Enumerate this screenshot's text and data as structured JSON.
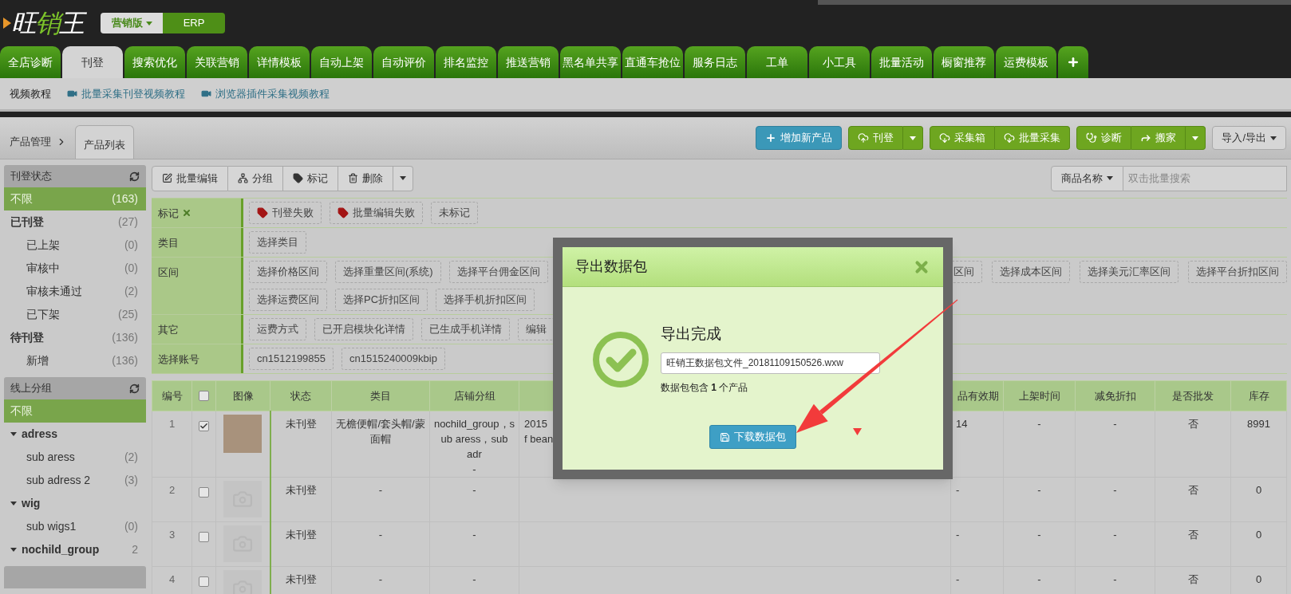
{
  "header": {
    "logo": "旺销王",
    "modes": [
      {
        "label": "营销版",
        "selected": true,
        "dropdown": true
      },
      {
        "label": "ERP",
        "selected": false
      }
    ]
  },
  "nav_tabs": [
    {
      "label": "全店诊断",
      "selected": false
    },
    {
      "label": "刊登",
      "selected": true
    },
    {
      "label": "搜索优化",
      "selected": false
    },
    {
      "label": "关联营销",
      "selected": false
    },
    {
      "label": "详情模板",
      "selected": false
    },
    {
      "label": "自动上架",
      "selected": false
    },
    {
      "label": "自动评价",
      "selected": false
    },
    {
      "label": "排名监控",
      "selected": false
    },
    {
      "label": "推送营销",
      "selected": false
    },
    {
      "label": "黑名单共享",
      "selected": false
    },
    {
      "label": "直通车抢位",
      "selected": false
    },
    {
      "label": "服务日志",
      "selected": false
    },
    {
      "label": "工单",
      "selected": false
    },
    {
      "label": "小工具",
      "selected": false
    },
    {
      "label": "批量活动",
      "selected": false
    },
    {
      "label": "橱窗推荐",
      "selected": false
    },
    {
      "label": "运费模板",
      "selected": false
    },
    {
      "kind": "add",
      "selected": false
    }
  ],
  "tutorial_bar": {
    "label": "视频教程",
    "links": [
      "批量采集刊登视频教程",
      "浏览器插件采集视频教程"
    ]
  },
  "breadcrumb": [
    {
      "label": "产品管理",
      "selected": false
    },
    {
      "label": "产品列表",
      "selected": true
    }
  ],
  "toolbar": [
    {
      "buttons": [
        {
          "label": "增加新产品"
        }
      ]
    },
    {
      "buttons": [
        {
          "label": "刊登"
        },
        {
          "kind": "caret"
        }
      ]
    },
    {
      "buttons": [
        {
          "label": "采集箱"
        },
        {
          "label": "批量采集"
        }
      ]
    },
    {
      "buttons": [
        {
          "label": "诊断"
        },
        {
          "label": "搬家"
        },
        {
          "kind": "caret"
        }
      ]
    },
    {
      "buttons": [
        {
          "label": "导入/导出",
          "dropdown": true
        }
      ]
    }
  ],
  "sidebar": {
    "panels": [
      {
        "title": "刊登状态",
        "items": [
          {
            "label": "不限",
            "count": "(163)",
            "selected": true
          },
          {
            "label": "已刊登",
            "count": "(27)",
            "selected": false,
            "children": [
              {
                "label": "已上架",
                "count": "(0)",
                "selected": false
              },
              {
                "label": "审核中",
                "count": "(0)",
                "selected": false
              },
              {
                "label": "审核未通过",
                "count": "(2)",
                "selected": false
              },
              {
                "label": "已下架",
                "count": "(25)",
                "selected": false
              }
            ]
          },
          {
            "label": "待刊登",
            "count": "(136)",
            "selected": false,
            "children": [
              {
                "label": "新增",
                "count": "(136)",
                "selected": false
              }
            ]
          }
        ]
      },
      {
        "title": "线上分组",
        "items": [
          {
            "label": "不限",
            "selected": true
          },
          {
            "label": "adress",
            "selected": false,
            "expanded": true,
            "children": [
              {
                "label": "sub aress",
                "count": "(2)",
                "selected": false
              },
              {
                "label": "sub adress 2",
                "count": "(3)",
                "selected": false
              }
            ]
          },
          {
            "label": "wig",
            "selected": false,
            "expanded": true,
            "children": [
              {
                "label": "sub wigs1",
                "count": "(0)",
                "selected": false
              }
            ]
          },
          {
            "label": "nochild_group",
            "count": "2",
            "selected": false,
            "expanded": true
          }
        ]
      }
    ]
  },
  "action_bar": [
    {
      "label": "批量编辑"
    },
    {
      "label": "分组"
    },
    {
      "label": "标记"
    },
    {
      "label": "删除"
    },
    {
      "kind": "caret"
    }
  ],
  "search": {
    "field_select": "商品名称",
    "placeholder": "双击批量搜索"
  },
  "filters": [
    {
      "label": "标记",
      "clearable": true,
      "lines": [
        {
          "chips": [
            {
              "label": "刊登失败",
              "kind": "tag"
            },
            {
              "label": "批量编辑失败",
              "kind": "tag"
            },
            {
              "label": "未标记"
            }
          ]
        }
      ]
    },
    {
      "label": "类目",
      "lines": [
        {
          "chips": [
            {
              "label": "选择类目"
            }
          ]
        }
      ]
    },
    {
      "label": "区间",
      "lines": [
        {
          "chips": [
            {
              "label": "选择价格区间"
            },
            {
              "label": "选择重量区间(系统)"
            },
            {
              "label": "选择平台佣金区间"
            }
          ],
          "chips_end": [
            {
              "label": "区间"
            },
            {
              "label": "选择成本区间"
            },
            {
              "label": "选择美元汇率区间"
            },
            {
              "label": "选择平台折扣区间"
            }
          ]
        },
        {
          "chips": [
            {
              "label": "选择运费区间"
            },
            {
              "label": "选择PC折扣区间"
            },
            {
              "label": "选择手机折扣区间"
            }
          ]
        }
      ]
    },
    {
      "label": "其它",
      "lines": [
        {
          "chips": [
            {
              "label": "运费方式"
            },
            {
              "label": "已开启模块化详情"
            },
            {
              "label": "已生成手机详情"
            },
            {
              "label": "编辑"
            }
          ]
        }
      ]
    },
    {
      "label": "选择账号",
      "lines": [
        {
          "chips": [
            {
              "label": "cn1512199855"
            },
            {
              "label": "cn1515240009kbip"
            }
          ]
        }
      ]
    }
  ],
  "table": {
    "columns": [
      {
        "label": "编号"
      },
      {
        "kind": "checkbox",
        "checked": false
      },
      {
        "label": "图像"
      },
      {
        "label": "状态"
      },
      {
        "label": "类目"
      },
      {
        "label": "店铺分组"
      },
      {
        "kind": "blank"
      },
      {
        "label": "品有效期",
        "kind": "cut"
      },
      {
        "label": "上架时间"
      },
      {
        "label": "减免折扣"
      },
      {
        "label": "是否批发"
      },
      {
        "label": "库存"
      }
    ],
    "rows": [
      {
        "photo": true,
        "cells": [
          "1",
          true,
          null,
          "未刊登",
          "无檐便帽/套头帽/蒙面帽",
          [
            "nochild_group，s",
            "ub aress，sub adr",
            "-"
          ],
          [
            "2015",
            "f bean"
          ],
          "14",
          "-",
          "-",
          "否",
          "8991"
        ]
      },
      {
        "photo": false,
        "cells": [
          "2",
          false,
          null,
          "未刊登",
          "-",
          "-",
          null,
          "-",
          "-",
          "-",
          "否",
          "0"
        ]
      },
      {
        "photo": false,
        "cells": [
          "3",
          false,
          null,
          "未刊登",
          "-",
          "-",
          null,
          "-",
          "-",
          "-",
          "否",
          "0"
        ]
      },
      {
        "photo": false,
        "cells": [
          "4",
          false,
          null,
          "未刊登",
          "-",
          "-",
          null,
          "-",
          "-",
          "-",
          "否",
          "0"
        ]
      }
    ]
  },
  "modal": {
    "title": "导出数据包",
    "heading": "导出完成",
    "file_name": "旺销王数据包文件_20181109150526.wxw",
    "summary": "数据包包含 **1** 个产品",
    "button": "下载数据包"
  }
}
